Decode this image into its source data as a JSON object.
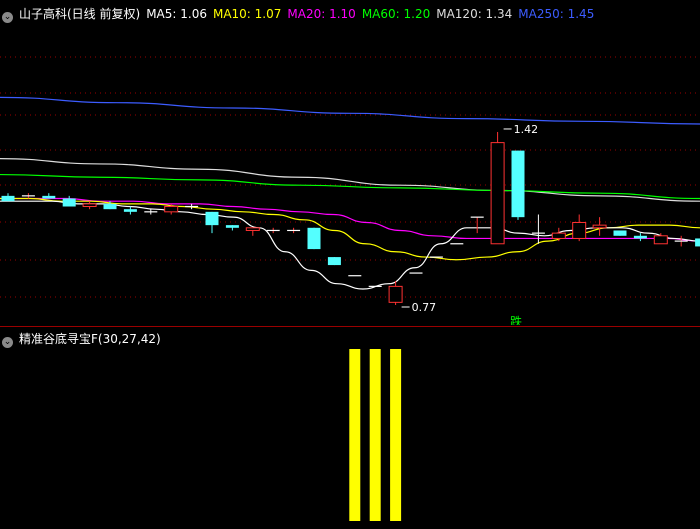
{
  "header": {
    "title": "山子高科(日线 前复权)",
    "ma": [
      {
        "label": "MA5: 1.06",
        "color": "#ffffff"
      },
      {
        "label": "MA10: 1.07",
        "color": "#ffff00"
      },
      {
        "label": "MA20: 1.10",
        "color": "#ff00ff"
      },
      {
        "label": "MA60: 1.20",
        "color": "#00ff00"
      },
      {
        "label": "MA120: 1.34",
        "color": "#dddddd"
      },
      {
        "label": "MA250: 1.45",
        "color": "#3c5cff"
      }
    ]
  },
  "indicator": {
    "title": "精准谷底寻宝F",
    "params": "(30,27,42)",
    "color": "#ffff00"
  },
  "annotations": {
    "high": "1.42",
    "low": "0.77",
    "signal": "跌",
    "signal_color": "#00ff00"
  },
  "colors": {
    "up": "#ff3232",
    "down": "#54ffff",
    "grid": "#9a0000"
  },
  "chart_data": [
    {
      "type": "candlestick",
      "yscale": [
        0.7,
        1.5
      ],
      "candles": [
        {
          "o": 1.18,
          "h": 1.19,
          "l": 1.16,
          "c": 1.16,
          "d": 0
        },
        {
          "o": 1.18,
          "h": 1.19,
          "l": 1.17,
          "c": 1.18,
          "d": 1
        },
        {
          "o": 1.18,
          "h": 1.19,
          "l": 1.17,
          "c": 1.17,
          "d": 0
        },
        {
          "o": 1.17,
          "h": 1.18,
          "l": 1.14,
          "c": 1.14,
          "d": 0
        },
        {
          "o": 1.14,
          "h": 1.16,
          "l": 1.13,
          "c": 1.15,
          "d": 1
        },
        {
          "o": 1.15,
          "h": 1.16,
          "l": 1.13,
          "c": 1.13,
          "d": 0
        },
        {
          "o": 1.13,
          "h": 1.14,
          "l": 1.11,
          "c": 1.12,
          "d": 0
        },
        {
          "o": 1.12,
          "h": 1.13,
          "l": 1.11,
          "c": 1.12,
          "d": 0
        },
        {
          "o": 1.12,
          "h": 1.15,
          "l": 1.11,
          "c": 1.14,
          "d": 1
        },
        {
          "o": 1.14,
          "h": 1.15,
          "l": 1.13,
          "c": 1.14,
          "d": 0
        },
        {
          "o": 1.12,
          "h": 1.12,
          "l": 1.04,
          "c": 1.07,
          "d": 0
        },
        {
          "o": 1.07,
          "h": 1.07,
          "l": 1.05,
          "c": 1.06,
          "d": 0
        },
        {
          "o": 1.05,
          "h": 1.06,
          "l": 1.03,
          "c": 1.06,
          "d": 1
        },
        {
          "o": 1.05,
          "h": 1.06,
          "l": 1.04,
          "c": 1.05,
          "d": 1
        },
        {
          "o": 1.05,
          "h": 1.06,
          "l": 1.04,
          "c": 1.05,
          "d": 1
        },
        {
          "o": 1.06,
          "h": 1.06,
          "l": 0.98,
          "c": 0.98,
          "d": 0
        },
        {
          "o": 0.95,
          "h": 0.95,
          "l": 0.92,
          "c": 0.92,
          "d": 0
        },
        {
          "o": 0.88,
          "h": 0.88,
          "l": 0.88,
          "c": 0.88,
          "d": 0
        },
        {
          "o": 0.84,
          "h": 0.84,
          "l": 0.84,
          "c": 0.84,
          "d": 1
        },
        {
          "o": 0.78,
          "h": 0.86,
          "l": 0.77,
          "c": 0.84,
          "d": 1
        },
        {
          "o": 0.89,
          "h": 0.89,
          "l": 0.89,
          "c": 0.89,
          "d": 0
        },
        {
          "o": 0.95,
          "h": 0.95,
          "l": 0.95,
          "c": 0.95,
          "d": 0
        },
        {
          "o": 1.0,
          "h": 1.0,
          "l": 1.0,
          "c": 1.0,
          "d": 0
        },
        {
          "o": 1.1,
          "h": 1.1,
          "l": 1.04,
          "c": 1.1,
          "d": 1
        },
        {
          "o": 1.0,
          "h": 1.42,
          "l": 1.0,
          "c": 1.38,
          "d": 1
        },
        {
          "o": 1.35,
          "h": 1.35,
          "l": 1.09,
          "c": 1.1,
          "d": 0
        },
        {
          "o": 1.04,
          "h": 1.11,
          "l": 1.0,
          "c": 1.04,
          "d": 0
        },
        {
          "o": 1.02,
          "h": 1.06,
          "l": 1.01,
          "c": 1.04,
          "d": 1
        },
        {
          "o": 1.02,
          "h": 1.11,
          "l": 1.01,
          "c": 1.08,
          "d": 1
        },
        {
          "o": 1.06,
          "h": 1.1,
          "l": 1.03,
          "c": 1.07,
          "d": 1
        },
        {
          "o": 1.05,
          "h": 1.05,
          "l": 1.03,
          "c": 1.03,
          "d": 0
        },
        {
          "o": 1.03,
          "h": 1.04,
          "l": 1.01,
          "c": 1.02,
          "d": 0
        },
        {
          "o": 1.0,
          "h": 1.04,
          "l": 1.0,
          "c": 1.03,
          "d": 1
        },
        {
          "o": 1.01,
          "h": 1.03,
          "l": 0.99,
          "c": 1.01,
          "d": 1
        },
        {
          "o": 1.02,
          "h": 1.02,
          "l": 0.99,
          "c": 0.99,
          "d": 0
        }
      ],
      "ma5": [
        1.16,
        1.16,
        1.16,
        1.15,
        1.15,
        1.14,
        1.13,
        1.12,
        1.11,
        1.1,
        1.06,
        0.97,
        0.9,
        0.85,
        0.83,
        0.85,
        0.91,
        1.0,
        1.06,
        1.06,
        1.04,
        1.03,
        1.05,
        1.06,
        1.06,
        1.04,
        1.02,
        1.01
      ],
      "ma10": [
        1.17,
        1.17,
        1.16,
        1.16,
        1.15,
        1.15,
        1.14,
        1.13,
        1.12,
        1.11,
        1.09,
        1.05,
        1.0,
        0.97,
        0.95,
        0.94,
        0.95,
        0.97,
        1.01,
        1.04,
        1.06,
        1.07,
        1.07,
        1.06
      ],
      "ma20": [
        1.17,
        1.17,
        1.17,
        1.16,
        1.16,
        1.15,
        1.15,
        1.14,
        1.13,
        1.12,
        1.11,
        1.08,
        1.05,
        1.03,
        1.02,
        1.02,
        1.02,
        1.02,
        1.02,
        1.02,
        1.02,
        1.01
      ],
      "ma60": [
        1.26,
        1.25,
        1.24,
        1.22,
        1.21,
        1.2,
        1.19,
        1.17
      ],
      "ma120": [
        1.32,
        1.3,
        1.28,
        1.25,
        1.22,
        1.2,
        1.18,
        1.16
      ],
      "ma250": [
        1.55,
        1.53,
        1.51,
        1.49,
        1.47,
        1.46,
        1.45
      ]
    },
    {
      "type": "bar",
      "series": [
        {
          "name": "精准谷底寻宝F",
          "values": [
            1,
            1,
            1
          ]
        }
      ],
      "positions": [
        17,
        18,
        19
      ]
    }
  ]
}
